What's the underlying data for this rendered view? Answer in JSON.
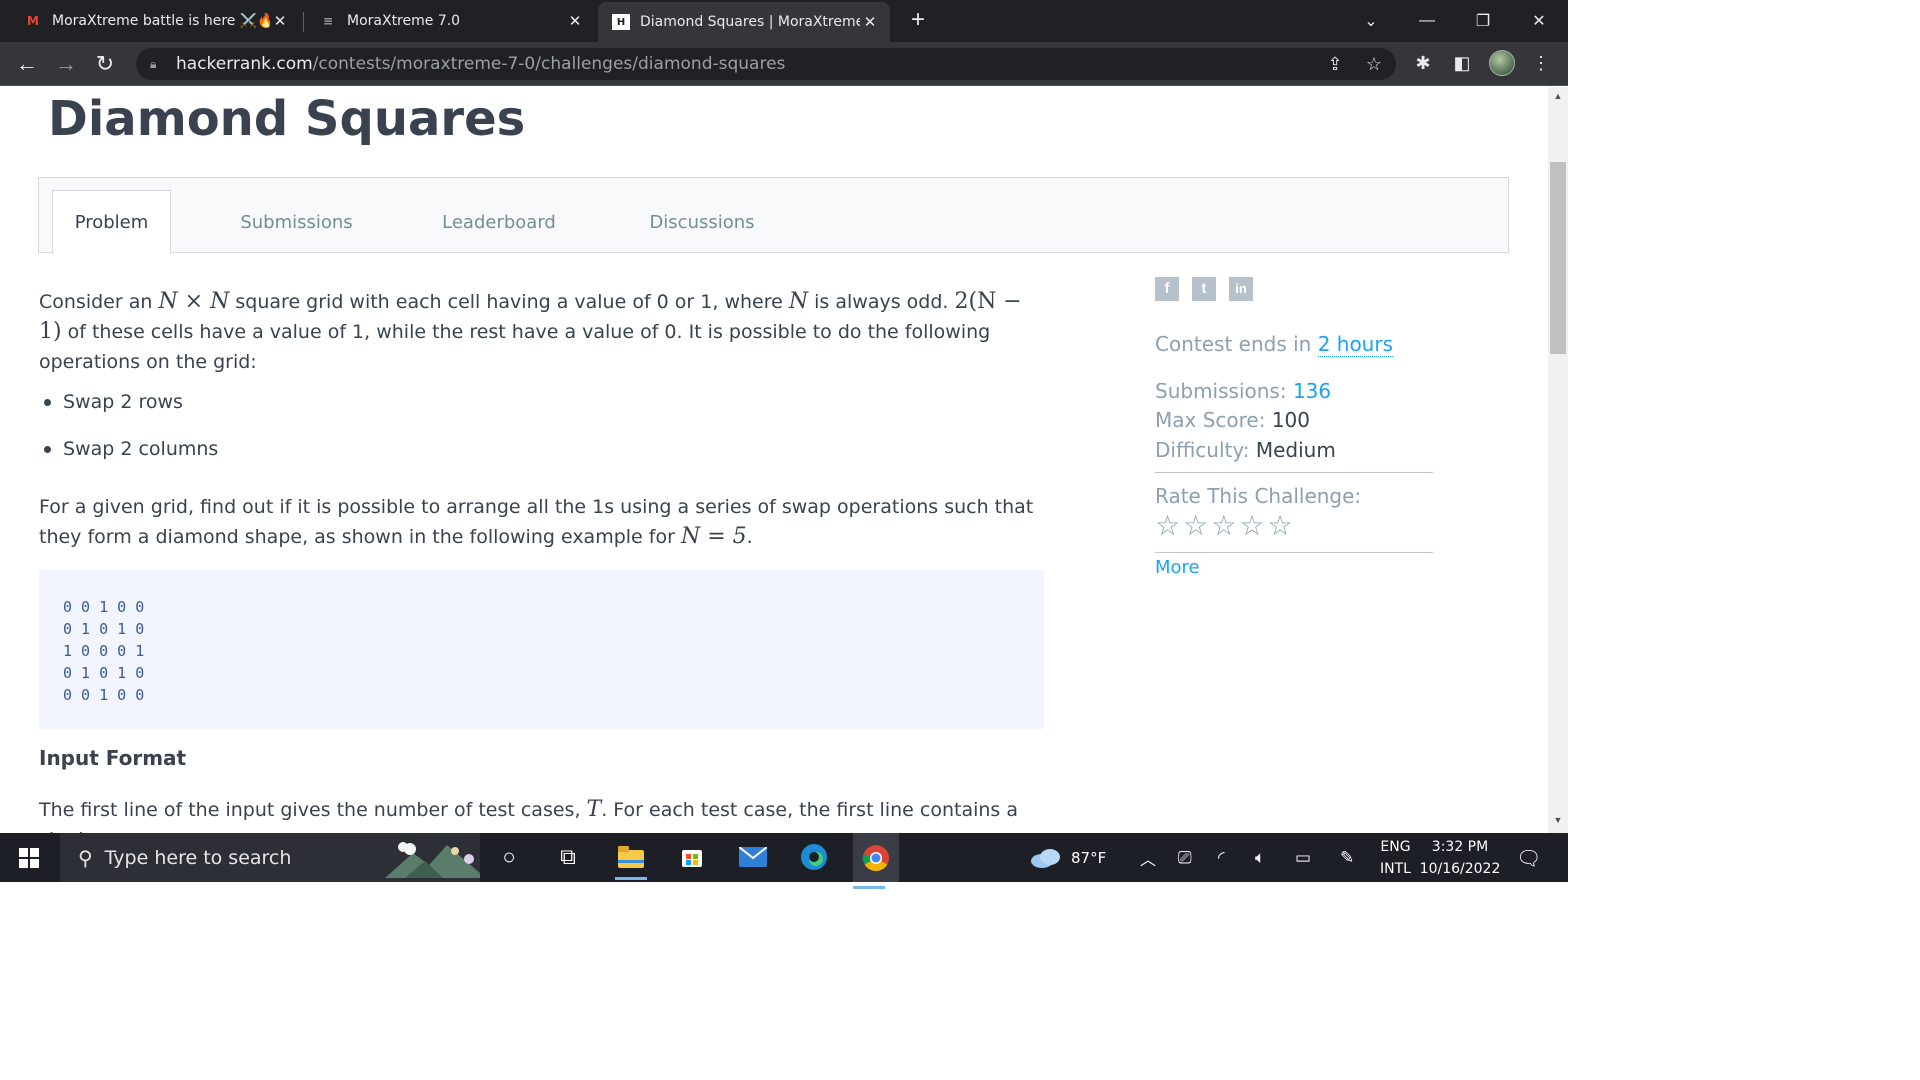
{
  "browser": {
    "tabs": [
      {
        "title": "MoraXtreme battle is here ⚔️🔥",
        "favicon": "M"
      },
      {
        "title": "MoraXtreme 7.0",
        "favicon": "≡"
      },
      {
        "title": "Diamond Squares | MoraXtreme",
        "favicon": "H",
        "active": true
      }
    ],
    "new_tab": "+",
    "url_host": "hackerrank.com",
    "url_path": "/contests/moraxtreme-7-0/challenges/diamond-squares"
  },
  "page": {
    "title": "Diamond Squares",
    "tabs": [
      "Problem",
      "Submissions",
      "Leaderboard",
      "Discussions"
    ],
    "problem": {
      "p1_a": "Consider an ",
      "p1_m1": "N × N",
      "p1_b": " square grid with each cell having a value of 0 or 1, where ",
      "p1_m2": "N",
      "p1_c": " is always odd. ",
      "p1_m3": "2(N − 1)",
      "p1_d": " of these cells have a value of 1, while the rest have a value of 0. It is possible to do the following operations on the grid:",
      "bullets": [
        "Swap 2 rows",
        "Swap 2 columns"
      ],
      "p2_a": "For a given grid, find out if it is possible to arrange all the 1s using a series of swap operations such that they form a diamond shape, as shown in the following example for ",
      "p2_m": "N = 5",
      "p2_b": ".",
      "code": "0 0 1 0 0\n0 1 0 1 0\n1 0 0 0 1\n0 1 0 1 0\n0 0 1 0 0",
      "input_heading": "Input Format",
      "p3_a": "The first line of the input gives the number of test cases, ",
      "p3_m": "T",
      "p3_b": ". For each test case, the first line contains a single"
    },
    "sidebar": {
      "contest_ends_label": "Contest ends in ",
      "contest_ends_value": "2 hours",
      "submissions_label": "Submissions:",
      "submissions_value": "136",
      "max_score_label": "Max Score:",
      "max_score_value": "100",
      "difficulty_label": "Difficulty:",
      "difficulty_value": "Medium",
      "rate_label": "Rate This Challenge:",
      "rating": 0,
      "more_label": "More"
    }
  },
  "taskbar": {
    "search_placeholder": "Type here to search",
    "weather": "87°F",
    "lang_top": "ENG",
    "lang_bottom": "INTL",
    "time": "3:32 PM",
    "date": "10/16/2022"
  },
  "colors": {
    "accent_link": "#1ba3f3",
    "heading": "#39424e",
    "muted_label": "#8ba0b1",
    "code_bg": "#f2f5fd"
  }
}
